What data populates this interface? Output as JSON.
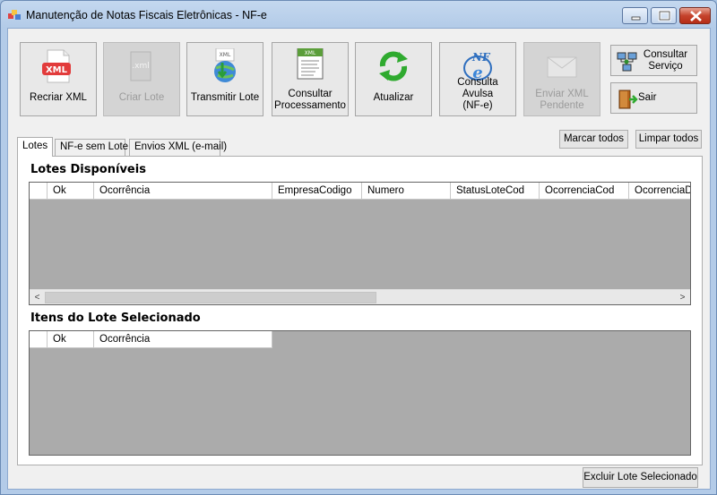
{
  "window": {
    "title": "Manutenção de Notas Fiscais Eletrônicas - NF-e"
  },
  "toolbar": {
    "recriar_xml": "Recriar XML",
    "criar_lote": "Criar Lote",
    "transmitir_lote": "Transmitir Lote",
    "consultar_processamento": "Consultar Processamento",
    "atualizar": "Atualizar",
    "consulta_avulsa": "Consulta Avulsa (NF-e)",
    "enviar_xml_pendente": "Enviar XML Pendente",
    "consultar_servico": "Consultar Serviço",
    "sair": "Sair"
  },
  "tabs": [
    {
      "label": "Lotes",
      "active": true
    },
    {
      "label": "NF-e sem Lote",
      "active": false
    },
    {
      "label": "Envios XML (e-mail)",
      "active": false
    }
  ],
  "actions": {
    "marcar_todos": "Marcar todos",
    "limpar_todos": "Limpar todos",
    "excluir_lote": "Excluir Lote Selecionado"
  },
  "lotes_grid": {
    "title": "Lotes Disponíveis",
    "columns": [
      "Ok",
      "Ocorrência",
      "EmpresaCodigo",
      "Numero",
      "StatusLoteCod",
      "OcorrenciaCod",
      "OcorrenciaD"
    ]
  },
  "itens_grid": {
    "title": "Itens do Lote Selecionado",
    "columns": [
      "Ok",
      "Ocorrência"
    ]
  },
  "icons": {
    "scroll_left": "<",
    "scroll_right": ">"
  }
}
